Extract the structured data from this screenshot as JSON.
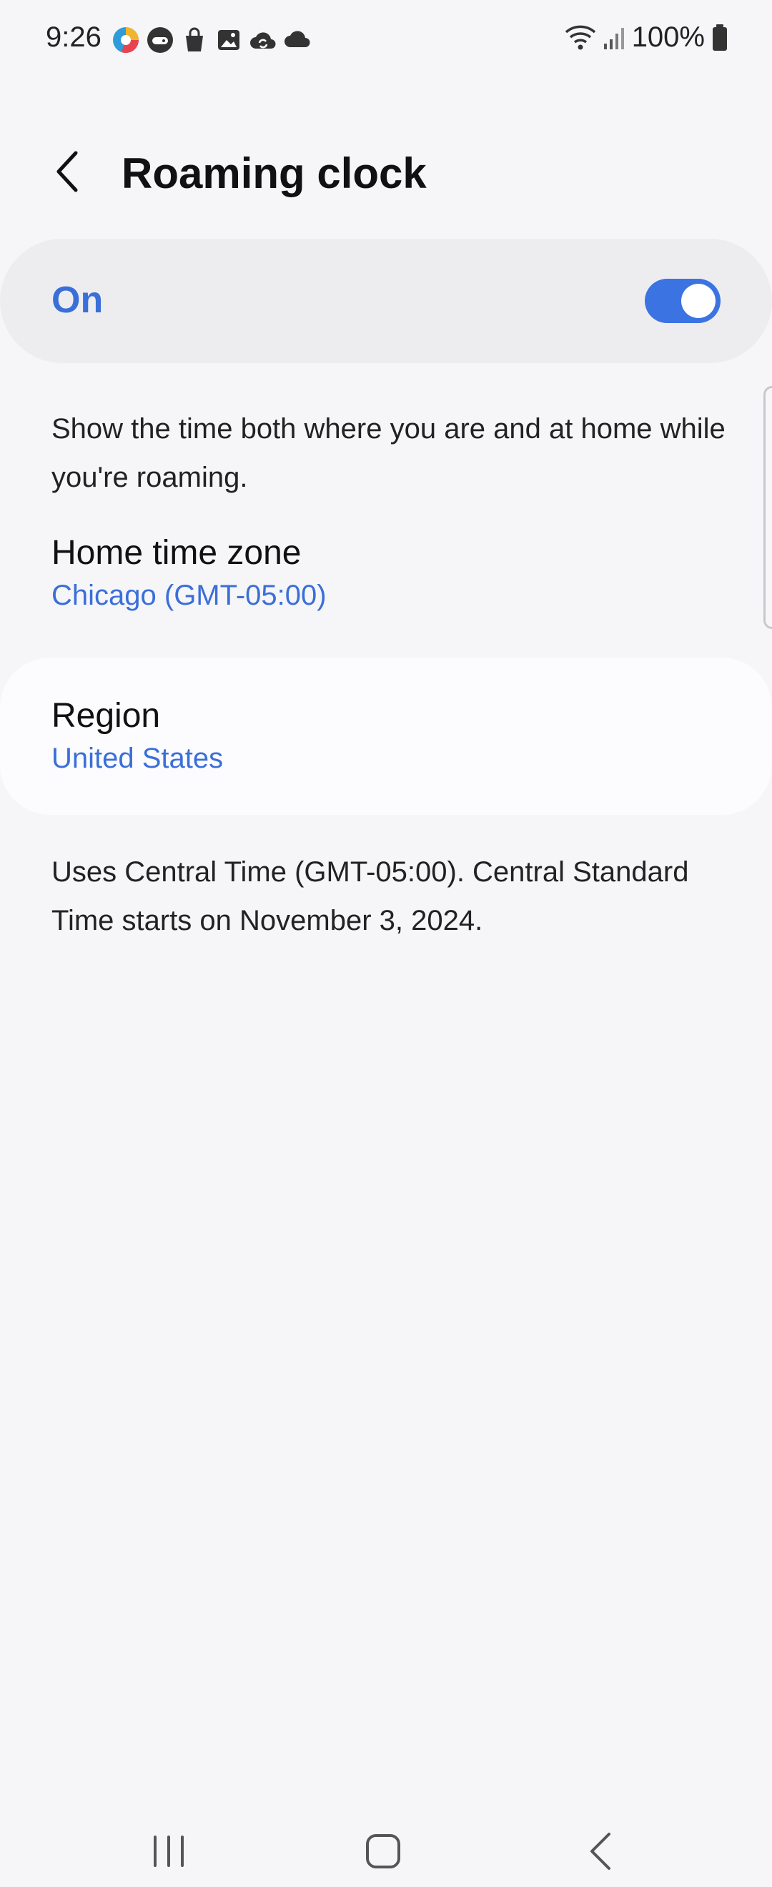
{
  "status_bar": {
    "time": "9:26",
    "battery": "100%",
    "notification_icons": [
      "chrome-like-app-icon",
      "game-controller-icon",
      "shopping-bag-icon",
      "gallery-icon",
      "cloud-sync-icon",
      "cloud-icon"
    ]
  },
  "header": {
    "title": "Roaming clock"
  },
  "master_switch": {
    "label": "On",
    "state": "on",
    "accent_color": "#3b73e2"
  },
  "description": "Show the time both where you are and at home while you're roaming.",
  "home_time_zone": {
    "title": "Home time zone",
    "value": "Chicago (GMT-05:00)"
  },
  "region": {
    "title": "Region",
    "value": "United States"
  },
  "footnote": "Uses Central Time (GMT-05:00). Central Standard Time starts on November 3, 2024."
}
